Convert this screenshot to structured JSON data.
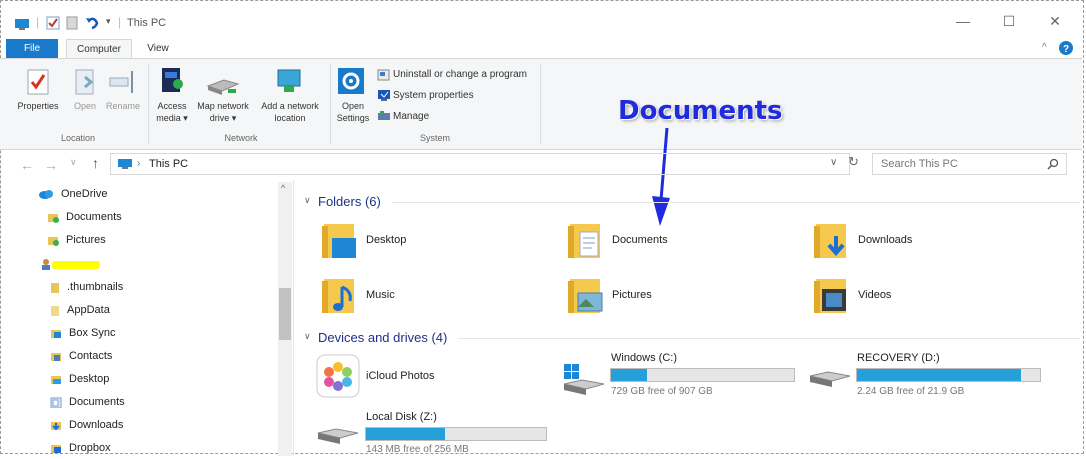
{
  "window": {
    "title": "This PC",
    "minimize": "—",
    "maximize": "☐",
    "close": "✕"
  },
  "ribbon": {
    "tabs": [
      "File",
      "Computer",
      "View"
    ],
    "buttons": {
      "properties": "Properties",
      "open": "Open",
      "rename": "Rename",
      "access_media": "Access media ▾",
      "map_drive": "Map network drive ▾",
      "add_location": "Add a network location",
      "open_settings": "Open Settings",
      "uninstall": "Uninstall or change a program",
      "system_properties": "System properties",
      "manage": "Manage"
    },
    "groups": [
      "Location",
      "Network",
      "System"
    ]
  },
  "address": {
    "path": "This PC",
    "search_placeholder": "Search This PC"
  },
  "nav": {
    "items": [
      "OneDrive",
      "Documents",
      "Pictures",
      "",
      ".thumbnails",
      "AppData",
      "Box Sync",
      "Contacts",
      "Desktop",
      "Documents",
      "Downloads",
      "Dropbox"
    ]
  },
  "content": {
    "folders_header": "Folders (6)",
    "folders": [
      "Desktop",
      "Documents",
      "Downloads",
      "Music",
      "Pictures",
      "Videos"
    ],
    "drives_header": "Devices and drives (4)",
    "icloud": "iCloud Photos",
    "drives": [
      {
        "name": "Windows (C:)",
        "free": "729 GB free of 907 GB",
        "used_fraction": 0.196
      },
      {
        "name": "RECOVERY (D:)",
        "free": "2.24 GB free of 21.9 GB",
        "used_fraction": 0.898
      },
      {
        "name": "Local Disk (Z:)",
        "free": "143 MB free of 256 MB",
        "used_fraction": 0.441
      }
    ]
  },
  "annotation": {
    "callout": "Documents"
  },
  "colors": {
    "accent": "#1979ca",
    "bar_fill": "#26a0da",
    "callout": "#1f2bdc",
    "highlight": "#ffff00"
  }
}
